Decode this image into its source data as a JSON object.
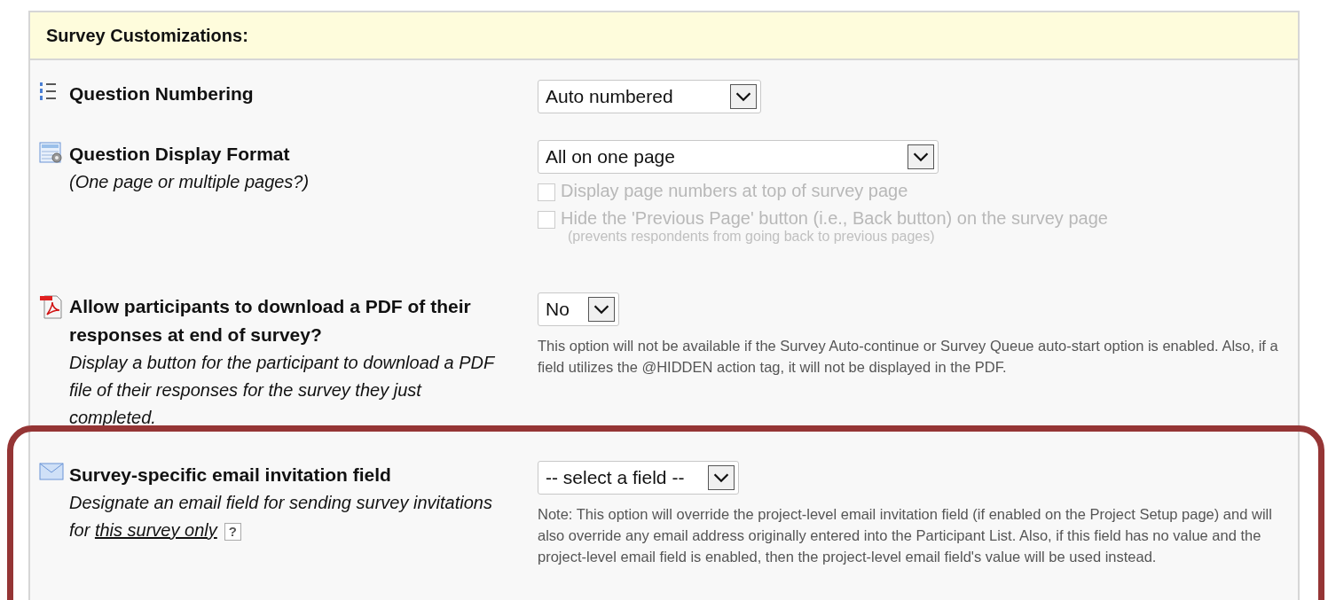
{
  "panel": {
    "title": "Survey Customizations:"
  },
  "settings": [
    {
      "kind": "numbering",
      "title": "Question Numbering",
      "dropdown": {
        "value": "Auto numbered"
      }
    },
    {
      "kind": "format",
      "title": "Question Display Format",
      "subtitle": "(One page or multiple pages?)",
      "dropdown": {
        "value": "All on one page"
      },
      "checkboxes": [
        {
          "label": "Display page numbers at top of survey page",
          "checked": false,
          "disabled": true
        },
        {
          "label": "Hide the 'Previous Page' button (i.e., Back button) on the survey page",
          "hint": "(prevents respondents from going back to previous pages)",
          "checked": false,
          "disabled": true
        }
      ]
    },
    {
      "kind": "pdf",
      "title": "Allow participants to download a PDF of their responses at end of survey?",
      "subtitle": "Display a button for the participant to download a PDF file of their responses for the survey they just completed.",
      "dropdown": {
        "value": "No"
      },
      "note": "This option will not be available if the Survey Auto-continue or Survey Queue auto-start option is enabled. Also, if a field utilizes the @HIDDEN action tag, it will not be displayed in the PDF."
    },
    {
      "kind": "email",
      "title": "Survey-specific email invitation field",
      "subtitle": "Designate an email field for sending survey invitations for",
      "link": "this survey only",
      "help": "?",
      "dropdown": {
        "value": "-- select a field --"
      },
      "note": "Note: This option will override the project-level email invitation field (if enabled on the Project Setup page) and will also override any email address originally entered into the Participant List. Also, if this field has no value and the project-level email field is enabled, then the project-level email field's value will be used instead.",
      "highlighted": true
    }
  ]
}
